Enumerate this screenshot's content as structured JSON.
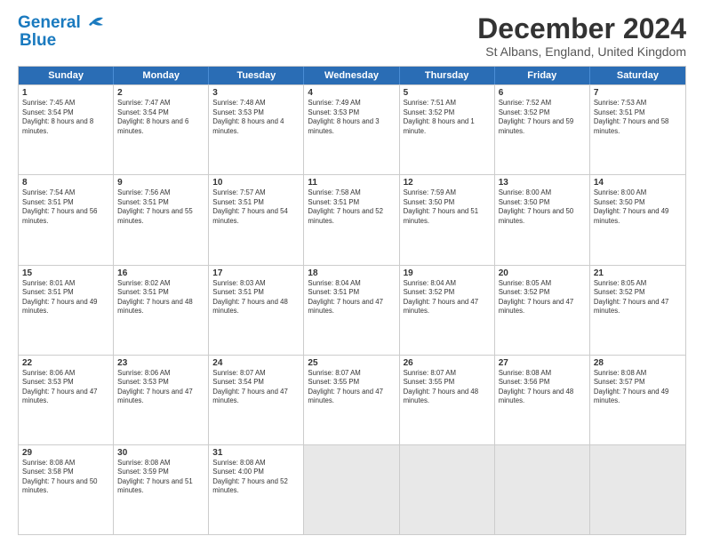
{
  "logo": {
    "line1": "General",
    "line2": "Blue"
  },
  "title": "December 2024",
  "subtitle": "St Albans, England, United Kingdom",
  "days": [
    "Sunday",
    "Monday",
    "Tuesday",
    "Wednesday",
    "Thursday",
    "Friday",
    "Saturday"
  ],
  "weeks": [
    [
      {
        "num": "1",
        "sr": "Sunrise: 7:45 AM",
        "ss": "Sunset: 3:54 PM",
        "dl": "Daylight: 8 hours and 8 minutes."
      },
      {
        "num": "2",
        "sr": "Sunrise: 7:47 AM",
        "ss": "Sunset: 3:54 PM",
        "dl": "Daylight: 8 hours and 6 minutes."
      },
      {
        "num": "3",
        "sr": "Sunrise: 7:48 AM",
        "ss": "Sunset: 3:53 PM",
        "dl": "Daylight: 8 hours and 4 minutes."
      },
      {
        "num": "4",
        "sr": "Sunrise: 7:49 AM",
        "ss": "Sunset: 3:53 PM",
        "dl": "Daylight: 8 hours and 3 minutes."
      },
      {
        "num": "5",
        "sr": "Sunrise: 7:51 AM",
        "ss": "Sunset: 3:52 PM",
        "dl": "Daylight: 8 hours and 1 minute."
      },
      {
        "num": "6",
        "sr": "Sunrise: 7:52 AM",
        "ss": "Sunset: 3:52 PM",
        "dl": "Daylight: 7 hours and 59 minutes."
      },
      {
        "num": "7",
        "sr": "Sunrise: 7:53 AM",
        "ss": "Sunset: 3:51 PM",
        "dl": "Daylight: 7 hours and 58 minutes."
      }
    ],
    [
      {
        "num": "8",
        "sr": "Sunrise: 7:54 AM",
        "ss": "Sunset: 3:51 PM",
        "dl": "Daylight: 7 hours and 56 minutes."
      },
      {
        "num": "9",
        "sr": "Sunrise: 7:56 AM",
        "ss": "Sunset: 3:51 PM",
        "dl": "Daylight: 7 hours and 55 minutes."
      },
      {
        "num": "10",
        "sr": "Sunrise: 7:57 AM",
        "ss": "Sunset: 3:51 PM",
        "dl": "Daylight: 7 hours and 54 minutes."
      },
      {
        "num": "11",
        "sr": "Sunrise: 7:58 AM",
        "ss": "Sunset: 3:51 PM",
        "dl": "Daylight: 7 hours and 52 minutes."
      },
      {
        "num": "12",
        "sr": "Sunrise: 7:59 AM",
        "ss": "Sunset: 3:50 PM",
        "dl": "Daylight: 7 hours and 51 minutes."
      },
      {
        "num": "13",
        "sr": "Sunrise: 8:00 AM",
        "ss": "Sunset: 3:50 PM",
        "dl": "Daylight: 7 hours and 50 minutes."
      },
      {
        "num": "14",
        "sr": "Sunrise: 8:00 AM",
        "ss": "Sunset: 3:50 PM",
        "dl": "Daylight: 7 hours and 49 minutes."
      }
    ],
    [
      {
        "num": "15",
        "sr": "Sunrise: 8:01 AM",
        "ss": "Sunset: 3:51 PM",
        "dl": "Daylight: 7 hours and 49 minutes."
      },
      {
        "num": "16",
        "sr": "Sunrise: 8:02 AM",
        "ss": "Sunset: 3:51 PM",
        "dl": "Daylight: 7 hours and 48 minutes."
      },
      {
        "num": "17",
        "sr": "Sunrise: 8:03 AM",
        "ss": "Sunset: 3:51 PM",
        "dl": "Daylight: 7 hours and 48 minutes."
      },
      {
        "num": "18",
        "sr": "Sunrise: 8:04 AM",
        "ss": "Sunset: 3:51 PM",
        "dl": "Daylight: 7 hours and 47 minutes."
      },
      {
        "num": "19",
        "sr": "Sunrise: 8:04 AM",
        "ss": "Sunset: 3:52 PM",
        "dl": "Daylight: 7 hours and 47 minutes."
      },
      {
        "num": "20",
        "sr": "Sunrise: 8:05 AM",
        "ss": "Sunset: 3:52 PM",
        "dl": "Daylight: 7 hours and 47 minutes."
      },
      {
        "num": "21",
        "sr": "Sunrise: 8:05 AM",
        "ss": "Sunset: 3:52 PM",
        "dl": "Daylight: 7 hours and 47 minutes."
      }
    ],
    [
      {
        "num": "22",
        "sr": "Sunrise: 8:06 AM",
        "ss": "Sunset: 3:53 PM",
        "dl": "Daylight: 7 hours and 47 minutes."
      },
      {
        "num": "23",
        "sr": "Sunrise: 8:06 AM",
        "ss": "Sunset: 3:53 PM",
        "dl": "Daylight: 7 hours and 47 minutes."
      },
      {
        "num": "24",
        "sr": "Sunrise: 8:07 AM",
        "ss": "Sunset: 3:54 PM",
        "dl": "Daylight: 7 hours and 47 minutes."
      },
      {
        "num": "25",
        "sr": "Sunrise: 8:07 AM",
        "ss": "Sunset: 3:55 PM",
        "dl": "Daylight: 7 hours and 47 minutes."
      },
      {
        "num": "26",
        "sr": "Sunrise: 8:07 AM",
        "ss": "Sunset: 3:55 PM",
        "dl": "Daylight: 7 hours and 48 minutes."
      },
      {
        "num": "27",
        "sr": "Sunrise: 8:08 AM",
        "ss": "Sunset: 3:56 PM",
        "dl": "Daylight: 7 hours and 48 minutes."
      },
      {
        "num": "28",
        "sr": "Sunrise: 8:08 AM",
        "ss": "Sunset: 3:57 PM",
        "dl": "Daylight: 7 hours and 49 minutes."
      }
    ],
    [
      {
        "num": "29",
        "sr": "Sunrise: 8:08 AM",
        "ss": "Sunset: 3:58 PM",
        "dl": "Daylight: 7 hours and 50 minutes."
      },
      {
        "num": "30",
        "sr": "Sunrise: 8:08 AM",
        "ss": "Sunset: 3:59 PM",
        "dl": "Daylight: 7 hours and 51 minutes."
      },
      {
        "num": "31",
        "sr": "Sunrise: 8:08 AM",
        "ss": "Sunset: 4:00 PM",
        "dl": "Daylight: 7 hours and 52 minutes."
      },
      {
        "num": "",
        "sr": "",
        "ss": "",
        "dl": ""
      },
      {
        "num": "",
        "sr": "",
        "ss": "",
        "dl": ""
      },
      {
        "num": "",
        "sr": "",
        "ss": "",
        "dl": ""
      },
      {
        "num": "",
        "sr": "",
        "ss": "",
        "dl": ""
      }
    ]
  ]
}
